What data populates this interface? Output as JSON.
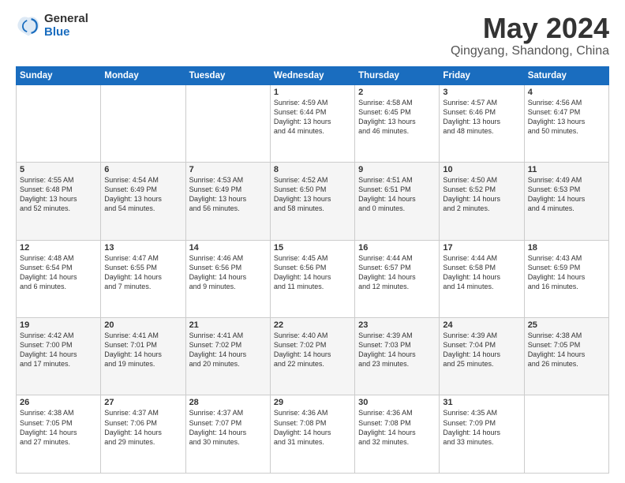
{
  "header": {
    "logo_general": "General",
    "logo_blue": "Blue",
    "title": "May 2024",
    "location": "Qingyang, Shandong, China"
  },
  "weekdays": [
    "Sunday",
    "Monday",
    "Tuesday",
    "Wednesday",
    "Thursday",
    "Friday",
    "Saturday"
  ],
  "weeks": [
    [
      {
        "day": "",
        "detail": ""
      },
      {
        "day": "",
        "detail": ""
      },
      {
        "day": "",
        "detail": ""
      },
      {
        "day": "1",
        "detail": "Sunrise: 4:59 AM\nSunset: 6:44 PM\nDaylight: 13 hours\nand 44 minutes."
      },
      {
        "day": "2",
        "detail": "Sunrise: 4:58 AM\nSunset: 6:45 PM\nDaylight: 13 hours\nand 46 minutes."
      },
      {
        "day": "3",
        "detail": "Sunrise: 4:57 AM\nSunset: 6:46 PM\nDaylight: 13 hours\nand 48 minutes."
      },
      {
        "day": "4",
        "detail": "Sunrise: 4:56 AM\nSunset: 6:47 PM\nDaylight: 13 hours\nand 50 minutes."
      }
    ],
    [
      {
        "day": "5",
        "detail": "Sunrise: 4:55 AM\nSunset: 6:48 PM\nDaylight: 13 hours\nand 52 minutes."
      },
      {
        "day": "6",
        "detail": "Sunrise: 4:54 AM\nSunset: 6:49 PM\nDaylight: 13 hours\nand 54 minutes."
      },
      {
        "day": "7",
        "detail": "Sunrise: 4:53 AM\nSunset: 6:49 PM\nDaylight: 13 hours\nand 56 minutes."
      },
      {
        "day": "8",
        "detail": "Sunrise: 4:52 AM\nSunset: 6:50 PM\nDaylight: 13 hours\nand 58 minutes."
      },
      {
        "day": "9",
        "detail": "Sunrise: 4:51 AM\nSunset: 6:51 PM\nDaylight: 14 hours\nand 0 minutes."
      },
      {
        "day": "10",
        "detail": "Sunrise: 4:50 AM\nSunset: 6:52 PM\nDaylight: 14 hours\nand 2 minutes."
      },
      {
        "day": "11",
        "detail": "Sunrise: 4:49 AM\nSunset: 6:53 PM\nDaylight: 14 hours\nand 4 minutes."
      }
    ],
    [
      {
        "day": "12",
        "detail": "Sunrise: 4:48 AM\nSunset: 6:54 PM\nDaylight: 14 hours\nand 6 minutes."
      },
      {
        "day": "13",
        "detail": "Sunrise: 4:47 AM\nSunset: 6:55 PM\nDaylight: 14 hours\nand 7 minutes."
      },
      {
        "day": "14",
        "detail": "Sunrise: 4:46 AM\nSunset: 6:56 PM\nDaylight: 14 hours\nand 9 minutes."
      },
      {
        "day": "15",
        "detail": "Sunrise: 4:45 AM\nSunset: 6:56 PM\nDaylight: 14 hours\nand 11 minutes."
      },
      {
        "day": "16",
        "detail": "Sunrise: 4:44 AM\nSunset: 6:57 PM\nDaylight: 14 hours\nand 12 minutes."
      },
      {
        "day": "17",
        "detail": "Sunrise: 4:44 AM\nSunset: 6:58 PM\nDaylight: 14 hours\nand 14 minutes."
      },
      {
        "day": "18",
        "detail": "Sunrise: 4:43 AM\nSunset: 6:59 PM\nDaylight: 14 hours\nand 16 minutes."
      }
    ],
    [
      {
        "day": "19",
        "detail": "Sunrise: 4:42 AM\nSunset: 7:00 PM\nDaylight: 14 hours\nand 17 minutes."
      },
      {
        "day": "20",
        "detail": "Sunrise: 4:41 AM\nSunset: 7:01 PM\nDaylight: 14 hours\nand 19 minutes."
      },
      {
        "day": "21",
        "detail": "Sunrise: 4:41 AM\nSunset: 7:02 PM\nDaylight: 14 hours\nand 20 minutes."
      },
      {
        "day": "22",
        "detail": "Sunrise: 4:40 AM\nSunset: 7:02 PM\nDaylight: 14 hours\nand 22 minutes."
      },
      {
        "day": "23",
        "detail": "Sunrise: 4:39 AM\nSunset: 7:03 PM\nDaylight: 14 hours\nand 23 minutes."
      },
      {
        "day": "24",
        "detail": "Sunrise: 4:39 AM\nSunset: 7:04 PM\nDaylight: 14 hours\nand 25 minutes."
      },
      {
        "day": "25",
        "detail": "Sunrise: 4:38 AM\nSunset: 7:05 PM\nDaylight: 14 hours\nand 26 minutes."
      }
    ],
    [
      {
        "day": "26",
        "detail": "Sunrise: 4:38 AM\nSunset: 7:05 PM\nDaylight: 14 hours\nand 27 minutes."
      },
      {
        "day": "27",
        "detail": "Sunrise: 4:37 AM\nSunset: 7:06 PM\nDaylight: 14 hours\nand 29 minutes."
      },
      {
        "day": "28",
        "detail": "Sunrise: 4:37 AM\nSunset: 7:07 PM\nDaylight: 14 hours\nand 30 minutes."
      },
      {
        "day": "29",
        "detail": "Sunrise: 4:36 AM\nSunset: 7:08 PM\nDaylight: 14 hours\nand 31 minutes."
      },
      {
        "day": "30",
        "detail": "Sunrise: 4:36 AM\nSunset: 7:08 PM\nDaylight: 14 hours\nand 32 minutes."
      },
      {
        "day": "31",
        "detail": "Sunrise: 4:35 AM\nSunset: 7:09 PM\nDaylight: 14 hours\nand 33 minutes."
      },
      {
        "day": "",
        "detail": ""
      }
    ]
  ]
}
